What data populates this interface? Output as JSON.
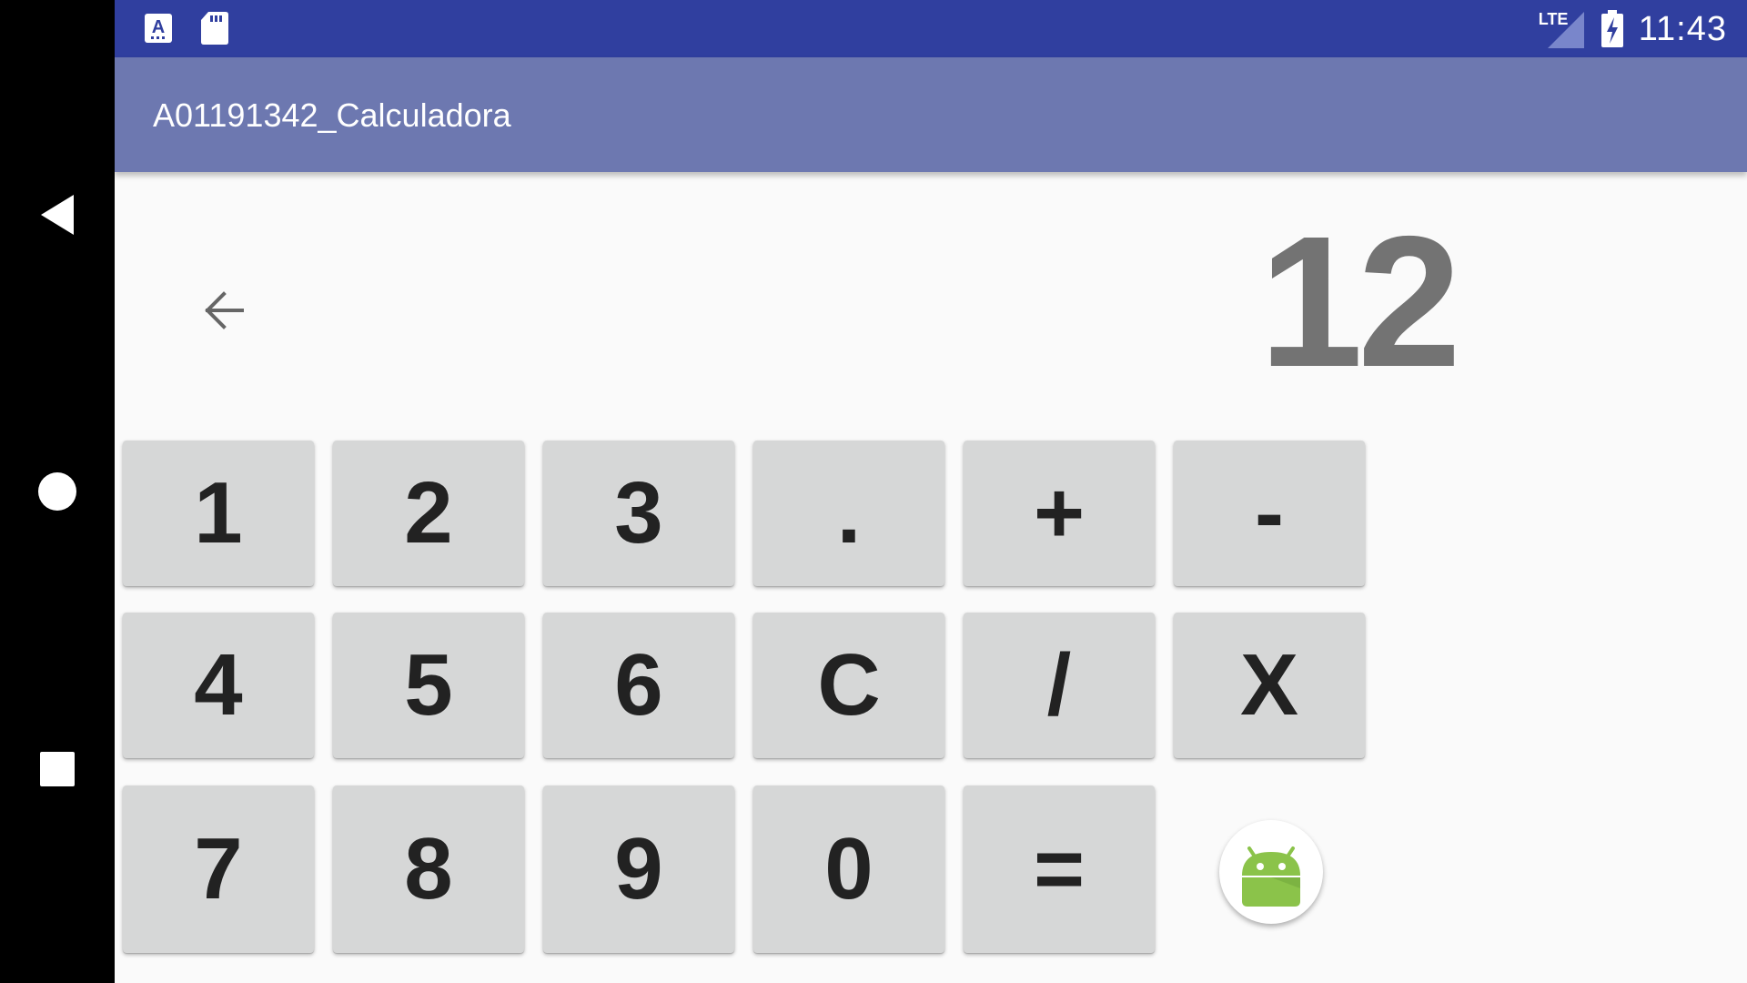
{
  "navigation": {
    "back_icon": "back-triangle-icon",
    "home_icon": "home-circle-icon",
    "recents_icon": "recents-square-icon"
  },
  "status_bar": {
    "left_icons": [
      "keyboard-a-icon",
      "sd-card-icon"
    ],
    "network_label": "LTE",
    "time": "11:43",
    "battery_icon": "battery-charging-icon",
    "colors": {
      "background": "#303f9f"
    }
  },
  "app_bar": {
    "title": "A01191342_Calculadora",
    "colors": {
      "background": "#6d78b0"
    }
  },
  "calculator": {
    "display_value": "12",
    "backspace_icon": "arrow-left-icon",
    "keys": [
      [
        "1",
        "2",
        "3",
        ".",
        "+",
        "-"
      ],
      [
        "4",
        "5",
        "6",
        "C",
        "/",
        "X"
      ],
      [
        "7",
        "8",
        "9",
        "0",
        "="
      ]
    ],
    "fab_icon": "android-robot-icon",
    "colors": {
      "key_background": "#d6d7d7",
      "display_text": "#737373"
    }
  }
}
